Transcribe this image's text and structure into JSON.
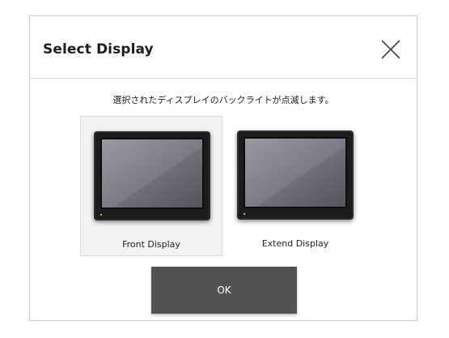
{
  "dialog": {
    "title": "Select Display",
    "message": "選択されたディスプレイのバックライトが点滅します。",
    "options": [
      {
        "label": "Front Display",
        "selected": true
      },
      {
        "label": "Extend Display",
        "selected": false
      }
    ],
    "ok_label": "OK",
    "close_icon": "close-icon"
  },
  "colors": {
    "ok_button": "#525252",
    "selected_bg": "#f3f3f3",
    "dialog_border": "#cfcfcf"
  }
}
